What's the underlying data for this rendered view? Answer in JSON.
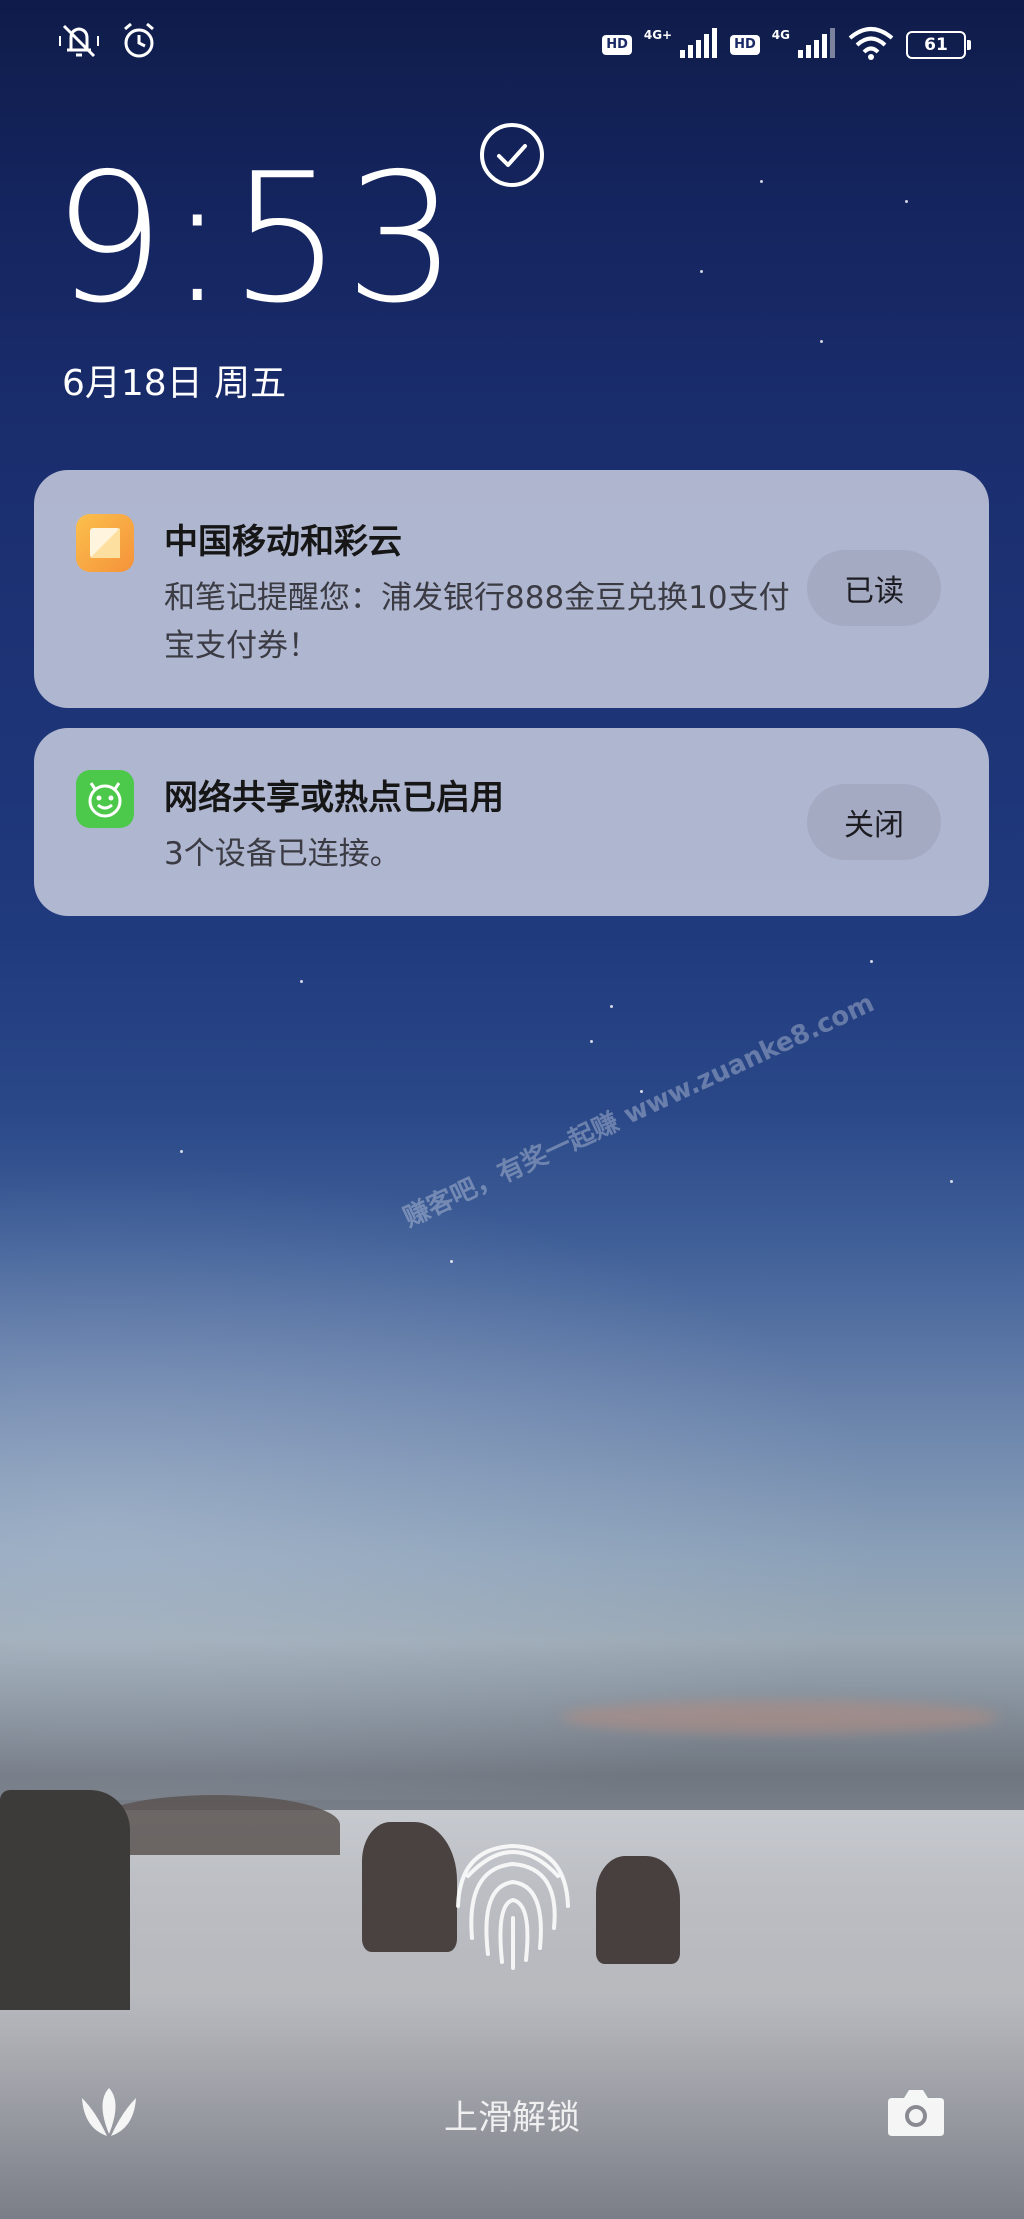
{
  "status_bar": {
    "network_hd_1": "HD",
    "network_type_1": "4G+",
    "network_hd_2": "HD",
    "network_type_2": "4G",
    "battery_level": "61"
  },
  "lock_screen": {
    "time": "9:53",
    "date": "6月18日 周五",
    "unlock_hint": "上滑解锁",
    "watermark": "赚客吧，有奖一起赚 www.zuanke8.com"
  },
  "notifications": [
    {
      "app_icon": "notes-app-icon",
      "title": "中国移动和彩云",
      "body": "和笔记提醒您：浦发银行888金豆兑换10支付宝支付券！",
      "action": "已读",
      "icon_color": "#f7a63a"
    },
    {
      "app_icon": "hotspot-app-icon",
      "title": "网络共享或热点已启用",
      "body": "3个设备已连接。",
      "action": "关闭",
      "icon_color": "#4cc94a"
    }
  ]
}
